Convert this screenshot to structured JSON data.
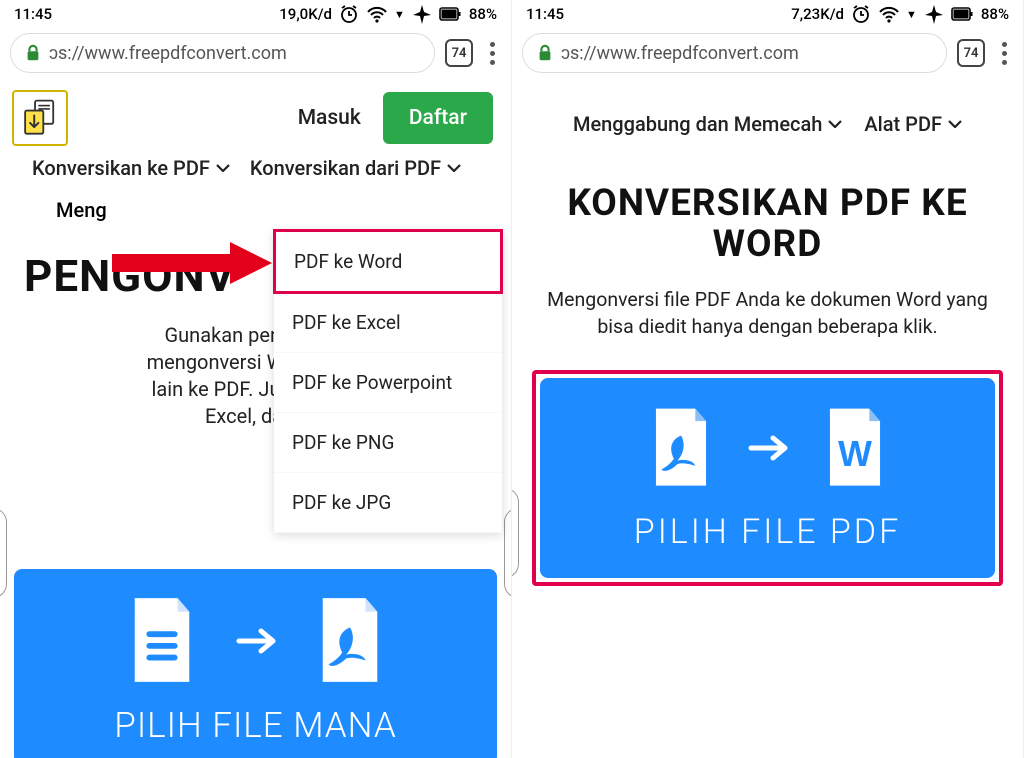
{
  "left": {
    "status": {
      "time": "11:45",
      "net": "19,0K/d",
      "battery": "88%"
    },
    "url": "ɔs://www.freepdfconvert.com",
    "tabs": "74",
    "links": {
      "masuk": "Masuk",
      "daftar": "Daftar"
    },
    "nav": {
      "toPdf": "Konversikan ke PDF",
      "fromPdf": "Konversikan dari PDF",
      "merge": "Meng"
    },
    "dropdown": [
      "PDF ke Word",
      "PDF ke Excel",
      "PDF ke Powerpoint",
      "PDF ke PNG",
      "PDF ke JPG"
    ],
    "title": "PENGONV",
    "desc1": "Gunakan pengonver:",
    "desc2": "mengonversi Word, Exce",
    "desc3": "lain ke PDF. Juga PDF k",
    "desc4": "Excel, dan (",
    "pick": "PILIH FILE MANA"
  },
  "right": {
    "status": {
      "time": "11:45",
      "net": "7,23K/d",
      "battery": "88%"
    },
    "url": "ɔs://www.freepdfconvert.com",
    "tabs": "74",
    "nav": {
      "merge": "Menggabung dan Memecah",
      "tools": "Alat PDF"
    },
    "title": "KONVERSIKAN PDF KE WORD",
    "desc": "Mengonversi file PDF Anda ke dokumen Word yang bisa diedit hanya dengan beberapa klik.",
    "pick": "PILIH FILE PDF"
  }
}
